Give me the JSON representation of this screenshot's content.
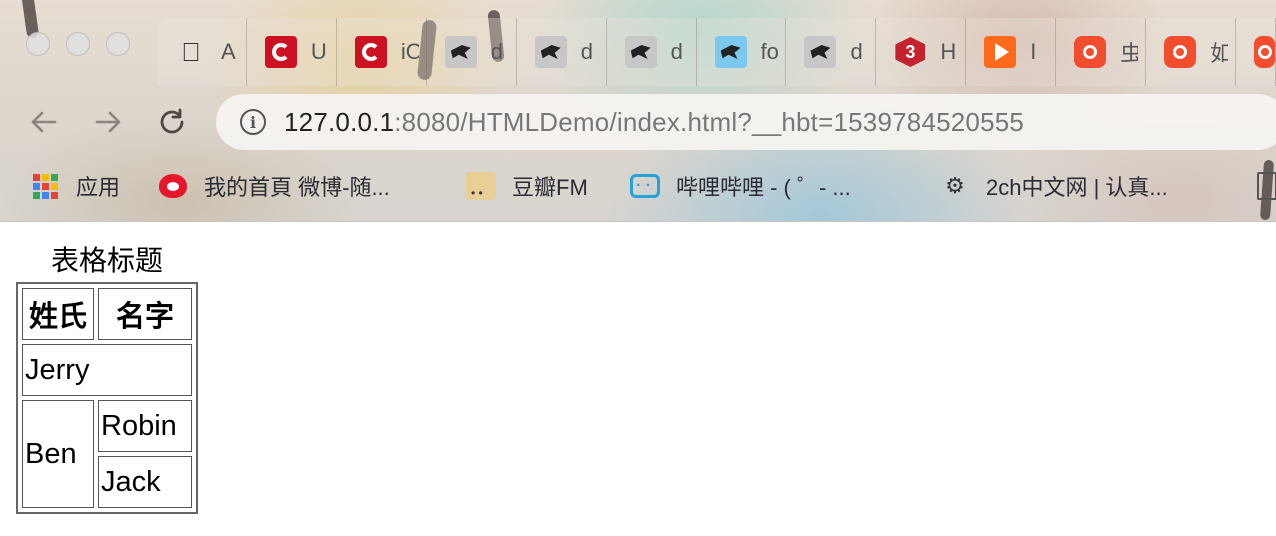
{
  "browser": {
    "tabs": [
      {
        "favicon": "apple-icon",
        "title": "A"
      },
      {
        "favicon": "c-logo-icon",
        "title": "U"
      },
      {
        "favicon": "c-logo-icon",
        "title": "iO"
      },
      {
        "favicon": "bird-icon",
        "title": "d"
      },
      {
        "favicon": "bird-icon",
        "title": "d"
      },
      {
        "favicon": "bird-icon",
        "title": "d"
      },
      {
        "favicon": "bird-blue-icon",
        "title": "fo"
      },
      {
        "favicon": "bird-icon",
        "title": "d"
      },
      {
        "favicon": "hexagon-3-icon",
        "title": "H"
      },
      {
        "favicon": "play-icon",
        "title": "I"
      },
      {
        "favicon": "music-icon",
        "title": "虫"
      },
      {
        "favicon": "music-icon",
        "title": "如"
      },
      {
        "favicon": "music-icon",
        "title": ""
      }
    ],
    "hex_label": "3",
    "address": {
      "host": "127.0.0.1",
      "rest": ":8080/HTMLDemo/index.html?__hbt=1539784520555"
    },
    "bookmarks": [
      {
        "icon": "apps-grid-icon",
        "label": "应用"
      },
      {
        "icon": "weibo-icon",
        "label": "我的首頁 微博-随..."
      },
      {
        "icon": "douban-icon",
        "label": "豆瓣FM"
      },
      {
        "icon": "bilibili-icon",
        "label": "哔哩哔哩 - ( ゜- ..."
      },
      {
        "icon": "2ch-icon",
        "label": "2ch中文网 | 认真..."
      },
      {
        "icon": "file-icon",
        "label": ""
      }
    ],
    "colors": {
      "apps_grid": [
        "#e94235",
        "#fbbc04",
        "#34a853",
        "#4285f4",
        "#e94235",
        "#fbbc04",
        "#34a853",
        "#4285f4",
        "#e94235"
      ]
    }
  },
  "page": {
    "caption": "表格标题",
    "headers": [
      "姓氏",
      "名字"
    ],
    "rows": {
      "jerry": "Jerry",
      "ben": "Ben",
      "robin": "Robin",
      "jack": "Jack"
    }
  }
}
